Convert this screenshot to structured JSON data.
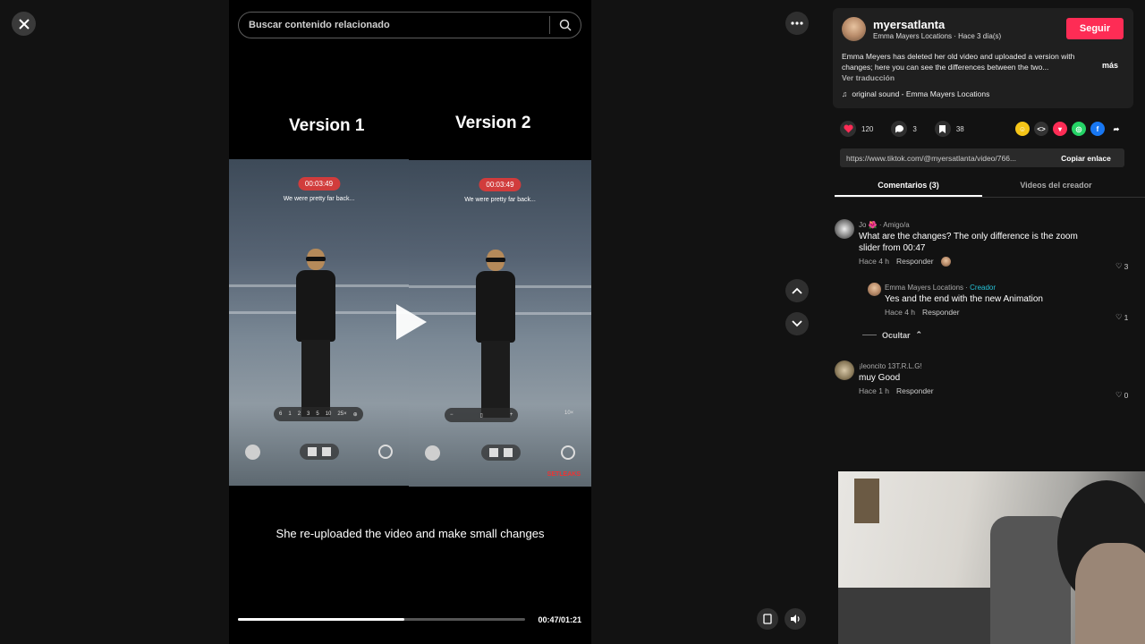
{
  "viewer": {
    "search_placeholder": "Buscar contenido relacionado",
    "version_1": "Version 1",
    "version_2": "Version 2",
    "clip_timer": "00:03:49",
    "clip_subtitle": "We were pretty far back...",
    "zoom_labels_left": [
      "6",
      "1",
      "2",
      "3",
      "5",
      "10",
      "25×"
    ],
    "zoom_label_right": "10×",
    "watermark": "SETLEAKS",
    "caption": "She re-uploaded the video and make small changes",
    "current_time": "00:47/01:21",
    "progress": 0.58
  },
  "post": {
    "username": "myersatlanta",
    "subtitle": "Emma Mayers Locations · Hace 3 día(s)",
    "follow_label": "Seguir",
    "description": "Emma Meyers has deleted her old video and uploaded a version with changes; here you can see the differences between the two...",
    "more_label": "más",
    "translate_label": "Ver traducción",
    "sound": "original sound - Emma Mayers Locations",
    "likes": "120",
    "comments": "3",
    "saves": "38",
    "url": "https://www.tiktok.com/@myersatlanta/video/766...",
    "copy_label": "Copiar enlace"
  },
  "tabs": {
    "comments": "Comentarios (3)",
    "creator_videos": "Videos del creador"
  },
  "comments": [
    {
      "author": "Jo 🌺 · Amigo/a",
      "text": "What are the changes? The only difference is the zoom slider from 00:47",
      "time": "Hace 4 h",
      "reply": "Responder",
      "likes": "3"
    },
    {
      "author": "Emma Mayers Locations",
      "badge": "Creador",
      "text": "Yes and the end with the new Animation",
      "time": "Hace 4 h",
      "reply": "Responder",
      "likes": "1"
    },
    {
      "author": "¡leoncito 13T.R.L.G!",
      "text": "muy Good",
      "time": "Hace 1 h",
      "reply": "Responder",
      "likes": "0"
    }
  ],
  "hide_label": "Ocultar",
  "colors": {
    "accent": "#fe2c55",
    "creator": "#25c1d6"
  }
}
